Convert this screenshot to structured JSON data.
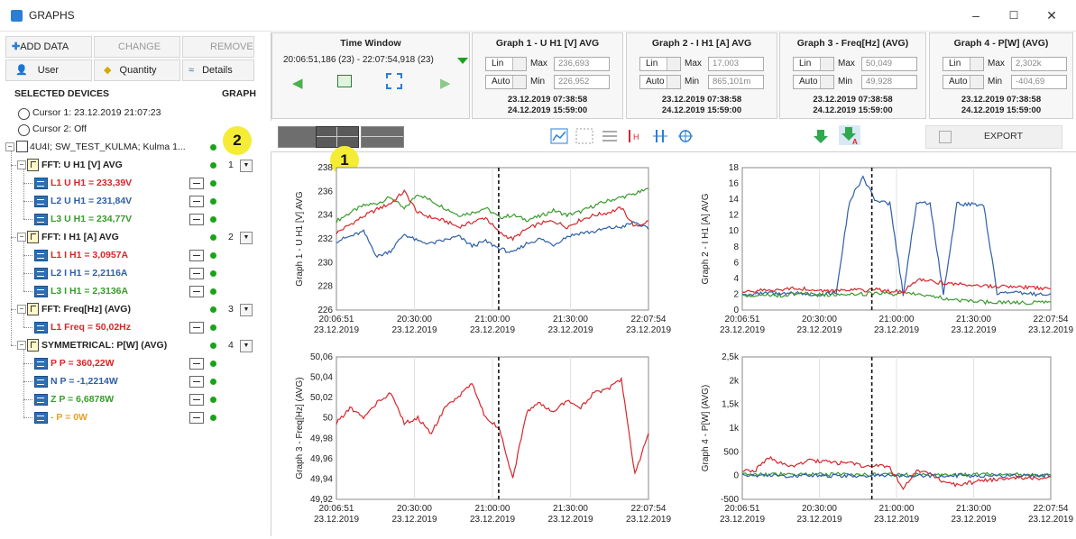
{
  "window": {
    "title": "GRAPHS",
    "minimize": "–",
    "maximize": "☐",
    "close": "✕"
  },
  "left": {
    "add_data": "ADD DATA",
    "change": "CHANGE",
    "remove": "REMOVE",
    "user": "User",
    "quantity": "Quantity",
    "details": "Details",
    "selected_devices": "SELECTED DEVICES",
    "graph_col": "GRAPH",
    "cursor1": "Cursor 1: 23.12.2019 21:07:23",
    "cursor2": "Cursor 2: Off",
    "device": "4U4I; SW_TEST_KULMA; Kulma 1...",
    "groups": [
      {
        "label": "FFT: U H1 [V] AVG",
        "graph": "1",
        "items": [
          {
            "label": "L1 U H1 = 233,39V",
            "color": "#d8262a"
          },
          {
            "label": "L2 U H1 = 231,84V",
            "color": "#2e5fa8"
          },
          {
            "label": "L3 U H1 = 234,77V",
            "color": "#3a9a2e"
          }
        ]
      },
      {
        "label": "FFT: I H1 [A] AVG",
        "graph": "2",
        "items": [
          {
            "label": "L1 I H1 = 3,0957A",
            "color": "#d8262a"
          },
          {
            "label": "L2 I H1 = 2,2116A",
            "color": "#2e5fa8"
          },
          {
            "label": "L3 I H1 = 2,3136A",
            "color": "#3a9a2e"
          }
        ]
      },
      {
        "label": "FFT: Freq[Hz] (AVG)",
        "graph": "3",
        "items": [
          {
            "label": "L1 Freq = 50,02Hz",
            "color": "#d8262a"
          }
        ]
      },
      {
        "label": "SYMMETRICAL: P[W] (AVG)",
        "graph": "4",
        "items": [
          {
            "label": "P P = 360,22W",
            "color": "#d8262a"
          },
          {
            "label": "N P = -1,2214W",
            "color": "#2e5fa8"
          },
          {
            "label": "Z P = 6,6878W",
            "color": "#3a9a2e"
          },
          {
            "label": "- P = 0W",
            "color": "#e8a020"
          }
        ]
      }
    ],
    "badge2": "2"
  },
  "time_window": {
    "title": "Time Window",
    "range": "20:06:51,186 (23) - 22:07:54,918 (23)"
  },
  "graph_panels": [
    {
      "title": "Graph 1 - U H1 [V] AVG",
      "scale": "Lin",
      "mode": "Auto",
      "max_label": "Max",
      "max": "236,693",
      "min_label": "Min",
      "min": "226,952",
      "from": "23.12.2019 07:38:58",
      "to": "24.12.2019 15:59:00"
    },
    {
      "title": "Graph 2 - I H1 [A] AVG",
      "scale": "Lin",
      "mode": "Auto",
      "max_label": "Max",
      "max": "17,003",
      "min_label": "Min",
      "min": "865,101m",
      "from": "23.12.2019 07:38:58",
      "to": "24.12.2019 15:59:00"
    },
    {
      "title": "Graph 3 - Freq[Hz] (AVG)",
      "scale": "Lin",
      "mode": "Auto",
      "max_label": "Max",
      "max": "50,049",
      "min_label": "Min",
      "min": "49,928",
      "from": "23.12.2019 07:38:58",
      "to": "24.12.2019 15:59:00"
    },
    {
      "title": "Graph 4 - P[W] (AVG)",
      "scale": "Lin",
      "mode": "Auto",
      "max_label": "Max",
      "max": "2,302k",
      "min_label": "Min",
      "min": "-404,69",
      "from": "23.12.2019 07:38:58",
      "to": "24.12.2019 15:59:00"
    }
  ],
  "toolbar": {
    "export": "EXPORT",
    "badge1": "1"
  },
  "chart_data": [
    {
      "type": "line",
      "ylabel": "Graph 1 - U H1 [V] AVG",
      "ylim": [
        226,
        238
      ],
      "yticks": [
        "226",
        "228",
        "230",
        "232",
        "234",
        "236",
        "238"
      ],
      "xticks": [
        [
          "20:06:51",
          "23.12.2019"
        ],
        [
          "20:30:00",
          "23.12.2019"
        ],
        [
          "21:00:00",
          "23.12.2019"
        ],
        [
          "21:30:00",
          "23.12.2019"
        ],
        [
          "22:07:54",
          "23.12.2019"
        ]
      ],
      "cursor_fraction": 0.52,
      "series": [
        {
          "color": "#3a9a2e",
          "values": [
            233.5,
            234.2,
            234.8,
            235.0,
            235.5,
            234.5,
            235.8,
            235.2,
            234.6,
            234.0,
            234.2,
            234.6,
            233.8,
            234.0,
            233.6,
            233.9,
            234.4,
            234.0,
            234.3,
            234.8,
            235.2,
            235.5,
            235.8,
            236.2
          ]
        },
        {
          "color": "#d8262a",
          "values": [
            232.5,
            233.2,
            233.9,
            234.5,
            235.0,
            236.0,
            234.2,
            233.8,
            233.5,
            233.0,
            233.4,
            233.8,
            232.5,
            232.0,
            232.8,
            233.3,
            233.5,
            233.0,
            233.6,
            234.0,
            234.2,
            234.6,
            233.0,
            233.5
          ]
        },
        {
          "color": "#2e5fa8",
          "values": [
            231.8,
            232.2,
            232.6,
            230.5,
            231.0,
            232.4,
            231.8,
            231.6,
            231.9,
            232.2,
            231.4,
            231.8,
            231.2,
            230.8,
            231.6,
            232.0,
            231.5,
            232.2,
            232.5,
            232.6,
            232.9,
            233.0,
            233.4,
            232.8
          ]
        }
      ]
    },
    {
      "type": "line",
      "ylabel": "Graph 2 - I H1 [A] AVG",
      "ylim": [
        0,
        18
      ],
      "yticks": [
        "0",
        "2",
        "4",
        "6",
        "8",
        "10",
        "12",
        "14",
        "16",
        "18"
      ],
      "xticks": [
        [
          "20:06:51",
          "23.12.2019"
        ],
        [
          "20:30:00",
          "23.12.2019"
        ],
        [
          "21:00:00",
          "23.12.2019"
        ],
        [
          "21:30:00",
          "23.12.2019"
        ],
        [
          "22:07:54",
          "23.12.2019"
        ]
      ],
      "cursor_fraction": 0.42,
      "series": [
        {
          "color": "#2e5fa8",
          "values": [
            2.0,
            2.0,
            2.1,
            2.0,
            2.1,
            2.0,
            2.0,
            2.2,
            13.8,
            16.8,
            13.6,
            13.5,
            2.0,
            13.6,
            13.5,
            2.0,
            13.4,
            13.4,
            13.3,
            2.2,
            2.2,
            2.1,
            2.0,
            2.1
          ]
        },
        {
          "color": "#3a9a2e",
          "values": [
            1.8,
            1.9,
            2.0,
            1.8,
            2.1,
            2.0,
            1.9,
            2.0,
            2.1,
            2.0,
            2.2,
            2.0,
            2.1,
            2.0,
            1.8,
            1.5,
            1.2,
            1.1,
            1.0,
            1.0,
            1.0,
            0.9,
            1.0,
            1.0
          ]
        },
        {
          "color": "#d8262a",
          "values": [
            2.2,
            2.4,
            2.6,
            2.5,
            2.8,
            2.6,
            2.4,
            2.5,
            2.6,
            2.5,
            2.6,
            2.4,
            2.3,
            3.8,
            3.6,
            3.4,
            3.3,
            3.2,
            3.1,
            3.0,
            3.0,
            2.9,
            2.8,
            2.7
          ]
        }
      ]
    },
    {
      "type": "line",
      "ylabel": "Graph 3 - Freq[Hz] (AVG)",
      "ylim": [
        49.92,
        50.06
      ],
      "yticks": [
        "49,92",
        "49,94",
        "49,96",
        "49,98",
        "50",
        "50,02",
        "50,04",
        "50,06"
      ],
      "xticks": [
        [
          "20:06:51",
          "23.12.2019"
        ],
        [
          "20:30:00",
          "23.12.2019"
        ],
        [
          "21:00:00",
          "23.12.2019"
        ],
        [
          "21:30:00",
          "23.12.2019"
        ],
        [
          "22:07:54",
          "23.12.2019"
        ]
      ],
      "cursor_fraction": 0.52,
      "series": [
        {
          "color": "#d8262a",
          "values": [
            49.995,
            50.01,
            50.0,
            50.015,
            50.025,
            49.995,
            50.0,
            49.985,
            50.01,
            50.02,
            50.035,
            50.0,
            49.99,
            49.94,
            50.005,
            50.015,
            50.005,
            50.018,
            50.01,
            50.025,
            50.028,
            50.038,
            49.945,
            49.985
          ]
        }
      ]
    },
    {
      "type": "line",
      "ylabel": "Graph 4 - P[W] (AVG)",
      "ylim": [
        -500,
        2500
      ],
      "yticks": [
        "-500",
        "0",
        "500",
        "1k",
        "1,5k",
        "2k",
        "2,5k"
      ],
      "xticks": [
        [
          "20:06:51",
          "23.12.2019"
        ],
        [
          "20:30:00",
          "23.12.2019"
        ],
        [
          "21:00:00",
          "23.12.2019"
        ],
        [
          "21:30:00",
          "23.12.2019"
        ],
        [
          "22:07:54",
          "23.12.2019"
        ]
      ],
      "cursor_fraction": 0.42,
      "series": [
        {
          "color": "#3a9a2e",
          "values": [
            20,
            25,
            20,
            30,
            25,
            20,
            25,
            30,
            20,
            25,
            20,
            25,
            15,
            20,
            25,
            20,
            15,
            20,
            25,
            20,
            20,
            25,
            20,
            20
          ]
        },
        {
          "color": "#2e5fa8",
          "values": [
            0,
            -5,
            0,
            -5,
            0,
            0,
            -5,
            0,
            0,
            -5,
            0,
            0,
            -5,
            0,
            0,
            -5,
            0,
            0,
            0,
            -5,
            0,
            0,
            -5,
            0
          ]
        },
        {
          "color": "#d8262a",
          "values": [
            100,
            120,
            380,
            250,
            200,
            320,
            300,
            260,
            280,
            180,
            220,
            150,
            -250,
            100,
            60,
            -150,
            -200,
            -150,
            -100,
            -80,
            -50,
            -40,
            -60,
            -30
          ]
        }
      ]
    }
  ]
}
